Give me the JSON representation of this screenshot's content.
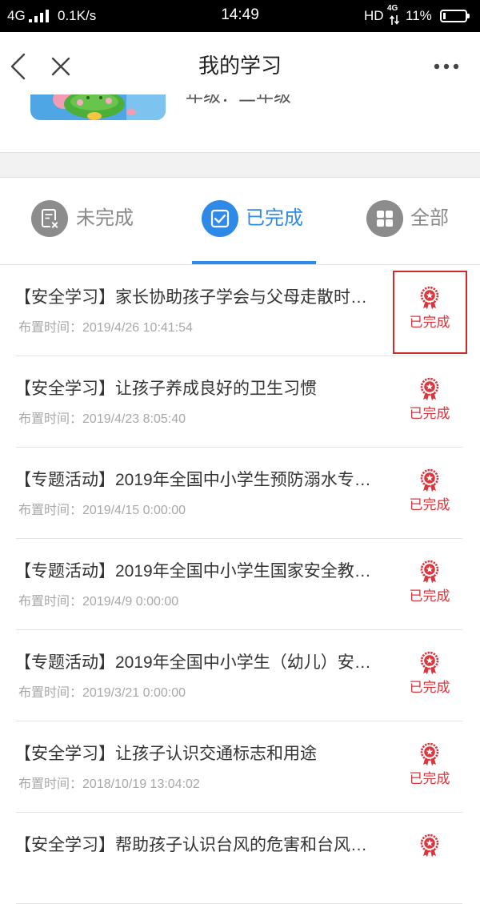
{
  "status_bar": {
    "network": "4G",
    "speed": "0.1K/s",
    "time": "14:49",
    "hd": "HD",
    "network_small": "4G",
    "battery": "11%",
    "battery_level": 0.11
  },
  "header": {
    "title": "我的学习",
    "back_icon": "chevron-left-icon",
    "close_icon": "close-icon",
    "more_icon": "more-dots-icon"
  },
  "profile": {
    "grade": "年级：二年级"
  },
  "tabs": [
    {
      "label": "未完成",
      "icon": "document-x-icon",
      "active": false
    },
    {
      "label": "已完成",
      "icon": "checkbox-icon",
      "active": true
    },
    {
      "label": "全部",
      "icon": "grid-icon",
      "active": false
    }
  ],
  "list": {
    "assigned_label": "布置时间：",
    "status_icon": "award-badge-icon",
    "items": [
      {
        "title": "【安全学习】家长协助孩子学会与父母走散时…",
        "assigned_time": "2019/4/26 10:41:54",
        "status": "已完成"
      },
      {
        "title": "【安全学习】让孩子养成良好的卫生习惯",
        "assigned_time": "2019/4/23 8:05:40",
        "status": "已完成"
      },
      {
        "title": "【专题活动】2019年全国中小学生预防溺水专…",
        "assigned_time": "2019/4/15 0:00:00",
        "status": "已完成"
      },
      {
        "title": "【专题活动】2019年全国中小学生国家安全教…",
        "assigned_time": "2019/4/9 0:00:00",
        "status": "已完成"
      },
      {
        "title": "【专题活动】2019年全国中小学生（幼儿）安…",
        "assigned_time": "2019/3/21 0:00:00",
        "status": "已完成"
      },
      {
        "title": "【安全学习】让孩子认识交通标志和用途",
        "assigned_time": "2018/10/19 13:04:02",
        "status": "已完成"
      },
      {
        "title": "【安全学习】帮助孩子认识台风的危害和台风…"
      }
    ]
  },
  "colors": {
    "accent": "#2e8ae6",
    "status_red": "#d9363e",
    "muted": "#a8a8a8",
    "icon_gray": "#8c8c8c"
  }
}
